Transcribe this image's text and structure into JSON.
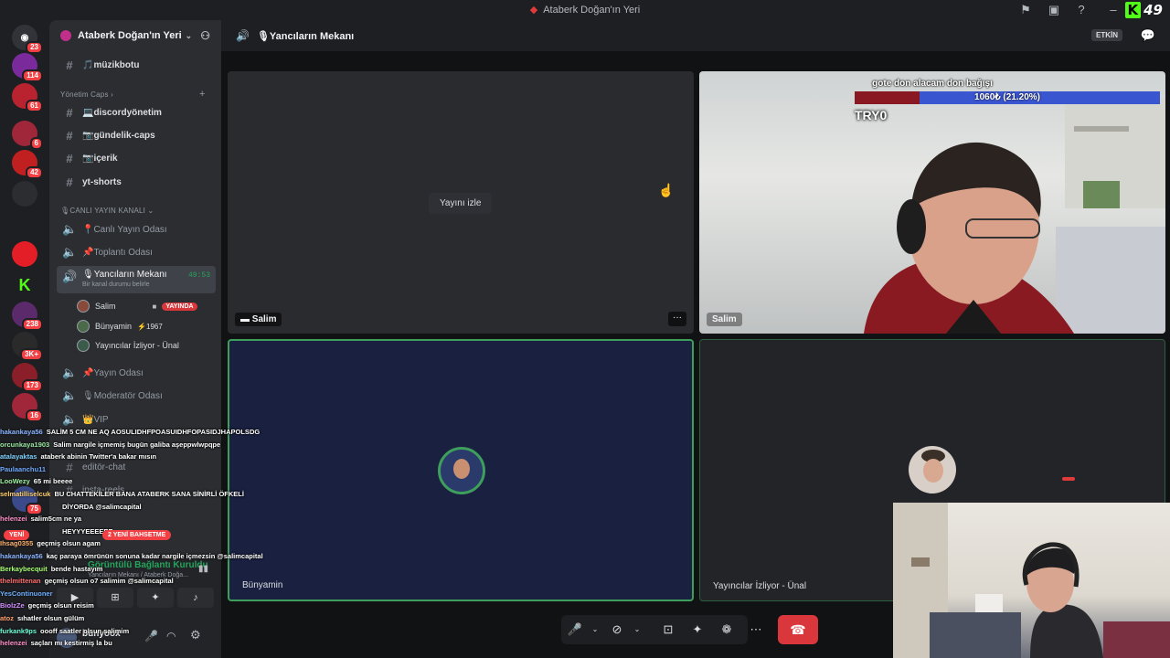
{
  "window": {
    "title": "Ataberk Doğan'ın Yeri"
  },
  "kick": {
    "letter": "K",
    "count": "49"
  },
  "rail": {
    "badges": [
      "23",
      "114",
      "61",
      "6",
      "42",
      "238",
      "3K+",
      "173",
      "16",
      "75"
    ]
  },
  "server": {
    "name": "Ataberk Doğan'ın Yeri"
  },
  "channels": {
    "muzikbotu": "🎵müzikbotu",
    "category_management": "Yönetim Caps",
    "discordyonetim": "💻discordyönetim",
    "gundelik": "📷gündelik-caps",
    "icerik": "📷içerik",
    "ytshorts": "yt-shorts",
    "category_live": "🎙CANLI YAYIN KANALI",
    "canli": "📍Canlı Yayın Odası",
    "toplanti": "📌Toplantı Odası",
    "yancilar": "🎙Yancıların Mekanı",
    "yancilar_time": "49:53",
    "yancilar_status": "Bir kanal durumu belirle",
    "yayin": "📌Yayın Odası",
    "moderator": "🎙Moderatör Odası",
    "vip": "👑VIP",
    "editor": "editör-chat",
    "insta": "insta-reels"
  },
  "members": [
    {
      "name": "Salim",
      "live": "YAYINDA"
    },
    {
      "name": "Bünyamin",
      "extra": "⚡1967"
    },
    {
      "name": "Yayıncılar İzliyor - Ünal"
    }
  ],
  "header": {
    "channel": "🎙Yancıların Mekanı",
    "active": "ETKİN"
  },
  "tiles": {
    "watch_stream": "Yayını izle",
    "top_left_name": "Salim",
    "top_right_name": "Salim",
    "bottom_left_name": "Bünyamin",
    "bottom_right_name": "Yayıncılar İzliyor - Ünal",
    "more": "···"
  },
  "overlay": {
    "donation_title": "gote don alacam don bağışı",
    "donation_amount": "1060₺ (21.20%)",
    "donation_progress": 0.212,
    "cam_id": "TRY0"
  },
  "chat": [
    {
      "user": "hakankaya56",
      "color": "#8ab4ff",
      "msg": "SALİM 5 CM NE AQ AOSULIDHFPOASUIDHFOPASIDJHAPOLSDG"
    },
    {
      "user": "orcunkaya1903",
      "color": "#9ae6a0",
      "msg": "Salim nargile içmemiş bugün galiba aşeppwlwpqpe"
    },
    {
      "user": "atalayaktas",
      "color": "#7fd3ff",
      "msg": "ataberk abinin Twitter'a bakar mısın"
    },
    {
      "user": "Paulaanchu11",
      "color": "#6fa8ff",
      "msg": ""
    },
    {
      "user": "LooWezy",
      "color": "#a0f0a0",
      "msg": "65 mi beeee"
    },
    {
      "user": "selmatilliselcuk",
      "color": "#ffd06f",
      "msg": "BU CHATTEKİLER BANA ATABERK SANA SİNİRLİ ÖFKELİ"
    },
    {
      "user": "",
      "color": "#ffffff",
      "msg": "DİYORDA @salimcapital"
    },
    {
      "user": "helenzei",
      "color": "#ff8fc8",
      "msg": "salim5cm ne ya"
    },
    {
      "user": "",
      "color": "#ffffff",
      "msg": "HEYYYEEEEEE"
    },
    {
      "user": "Ihsag0355",
      "color": "#ffb36f",
      "msg": "geçmiş olsun agam"
    },
    {
      "user": "hakankaya56",
      "color": "#8ab4ff",
      "msg": "kaç paraya ömrünün sonuna kadar nargile içmezsin @salimcapital"
    },
    {
      "user": "Berkaybecquit",
      "color": "#a6ff6f",
      "msg": "bende hastayım"
    },
    {
      "user": "thelmittenan",
      "color": "#ff6f6f",
      "msg": "geçmiş olsun o7 salimim @salimcapital"
    },
    {
      "user": "YesContinuoner",
      "color": "#6fb0ff",
      "msg": ""
    },
    {
      "user": "BiolzZe",
      "color": "#d08fff",
      "msg": "geçmiş olsun reisim"
    },
    {
      "user": "atoz",
      "color": "#ff9f6f",
      "msg": "sıhatler olsun gülüm"
    },
    {
      "user": "furkank9ps",
      "color": "#6fffd9",
      "msg": "oooff saatler olsun salimim"
    },
    {
      "user": "helenzei",
      "color": "#ff8fc8",
      "msg": "saçları mı kestirmiş la bu"
    }
  ],
  "voice": {
    "connected": "Görüntülü Bağlantı Kuruldu",
    "location": "Yancıların Mekanı / Ataberk Doğa...",
    "username": "bunyoox",
    "new_label": "YENİ",
    "mentions_label": "2 YENİ BAHSETME"
  },
  "colors": {
    "accent": "#5865f2",
    "live": "#da373c",
    "speaking": "#3e9e5c",
    "kick": "#53fc18"
  }
}
